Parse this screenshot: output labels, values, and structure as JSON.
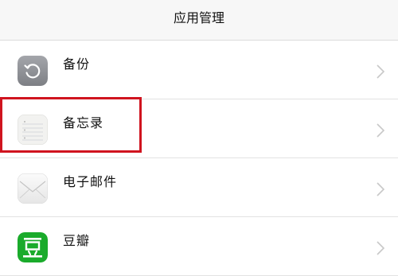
{
  "header": {
    "title": "应用管理"
  },
  "apps": [
    {
      "label": "备份",
      "icon": "backup-icon",
      "icon_bg": "#8e9095"
    },
    {
      "label": "备忘录",
      "icon": "notes-icon",
      "icon_bg": "#f2f2f0"
    },
    {
      "label": "电子邮件",
      "icon": "mail-icon",
      "icon_bg": "#f3f3f3"
    },
    {
      "label": "豆瓣",
      "icon": "douban-icon",
      "icon_bg": "#1aab2b"
    }
  ],
  "colors": {
    "highlight": "#d0141f",
    "chevron": "#c8c8c8",
    "header_bg": "#f7f7f7"
  }
}
